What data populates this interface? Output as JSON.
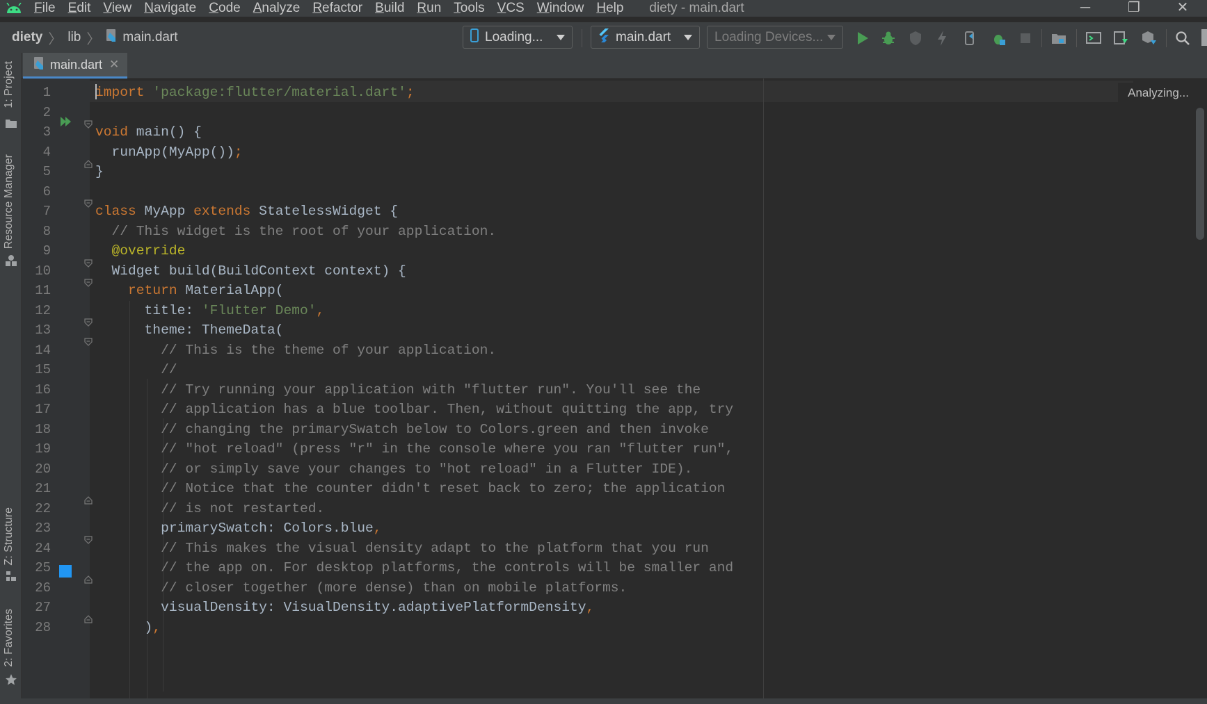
{
  "menubar": {
    "items": [
      {
        "label": "File"
      },
      {
        "label": "Edit"
      },
      {
        "label": "View"
      },
      {
        "label": "Navigate"
      },
      {
        "label": "Code"
      },
      {
        "label": "Analyze"
      },
      {
        "label": "Refactor"
      },
      {
        "label": "Build"
      },
      {
        "label": "Run"
      },
      {
        "label": "Tools"
      },
      {
        "label": "VCS"
      },
      {
        "label": "Window"
      },
      {
        "label": "Help"
      }
    ],
    "window_title": "diety - main.dart",
    "minimize": "─",
    "restore": "❐",
    "close": "✕"
  },
  "breadcrumb": {
    "project": "diety",
    "folder": "lib",
    "file": "main.dart"
  },
  "toolbar": {
    "device_combo": "Loading...",
    "config_combo": "main.dart",
    "devices_combo": "Loading Devices..."
  },
  "left_strip": {
    "project": "1: Project",
    "resource_manager": "Resource Manager",
    "structure": "Z: Structure",
    "favorites": "2: Favorites"
  },
  "tabs": [
    {
      "label": "main.dart",
      "close": "✕"
    }
  ],
  "editor": {
    "status": "Analyzing...",
    "line_numbers": [
      "1",
      "2",
      "3",
      "4",
      "5",
      "6",
      "7",
      "8",
      "9",
      "10",
      "11",
      "12",
      "13",
      "14",
      "15",
      "16",
      "17",
      "18",
      "19",
      "20",
      "21",
      "22",
      "23",
      "24",
      "25",
      "26",
      "27",
      "28"
    ],
    "gutter_color_swatch": "#2196f3"
  },
  "code": {
    "l1_kw": "import",
    "l1_str": "'package:flutter/material.dart'",
    "l1_end": ";",
    "l3_kw": "void",
    "l3_rest": " main() {",
    "l4": "  runApp(MyApp())",
    "l4_end": ";",
    "l5": "}",
    "l7_kw1": "class",
    "l7_mid": " MyApp ",
    "l7_kw2": "extends",
    "l7_rest": " StatelessWidget {",
    "l8": "  // This widget is the root of your application.",
    "l9": "  @override",
    "l10": "  Widget build(BuildContext context) {",
    "l11_pre": "    ",
    "l11_kw": "return",
    "l11_rest": " MaterialApp(",
    "l12_pre": "      title: ",
    "l12_str": "'Flutter Demo'",
    "l12_end": ",",
    "l13": "      theme: ThemeData(",
    "l14": "        // This is the theme of your application.",
    "l15": "        //",
    "l16": "        // Try running your application with \"flutter run\". You'll see the",
    "l17": "        // application has a blue toolbar. Then, without quitting the app, try",
    "l18": "        // changing the primarySwatch below to Colors.green and then invoke",
    "l19": "        // \"hot reload\" (press \"r\" in the console where you ran \"flutter run\",",
    "l20": "        // or simply save your changes to \"hot reload\" in a Flutter IDE).",
    "l21": "        // Notice that the counter didn't reset back to zero; the application",
    "l22": "        // is not restarted.",
    "l23": "        primarySwatch: Colors.blue",
    "l23_end": ",",
    "l24": "        // This makes the visual density adapt to the platform that you run",
    "l25": "        // the app on. For desktop platforms, the controls will be smaller and",
    "l26": "        // closer together (more dense) than on mobile platforms.",
    "l27": "        visualDensity: VisualDensity.adaptivePlatformDensity",
    "l27_end": ",",
    "l28": "      )",
    "l28_end": ","
  }
}
